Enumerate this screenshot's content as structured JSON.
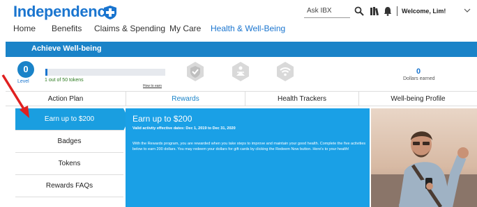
{
  "brand": {
    "name": "Independence",
    "logo_icon": "blue-cross-shield-icon",
    "color": "#1a75cf"
  },
  "header": {
    "search_placeholder": "Ask IBX",
    "welcome": "Welcome, Lim!",
    "icons": [
      "search-icon",
      "books-icon",
      "bell-icon",
      "chevron-down-icon"
    ]
  },
  "topnav": {
    "items": [
      "Home",
      "Benefits",
      "Claims & Spending",
      "My Care",
      "Health & Well-Being"
    ],
    "active": "Health & Well-Being"
  },
  "banner": {
    "title": "Achieve Well-being",
    "color": "#1a83c8"
  },
  "progress": {
    "level_value": "0",
    "level_label": "Level",
    "tokens_text": "1 out of 50 tokens",
    "tokens_earned": 1,
    "tokens_total": 50,
    "how_to_earn": "How to earn",
    "token_icons": [
      "checkmark-shield-token-icon",
      "meditation-person-token-icon",
      "wifi-token-icon"
    ],
    "dollars_value": "0",
    "dollars_label": "Dollars earned"
  },
  "tabs": {
    "items": [
      "Action Plan",
      "Rewards",
      "Health Trackers",
      "Well-being Profile"
    ],
    "active": "Rewards"
  },
  "leftnav": {
    "items": [
      "Earn up to $200",
      "Badges",
      "Tokens",
      "Rewards FAQs"
    ],
    "active": "Earn up to $200"
  },
  "panel": {
    "title": "Earn up to $200",
    "dates": "Valid activity effective dates: Dec 1, 2019 to Dec 31, 2020",
    "body": "With the Rewards program, you are rewarded when you take steps to improve and maintain your good health. Complete the five activities below to earn 200 dollars. You may redeem your dollars for gift cards by clicking the Redeem Now button. Here's to your health!",
    "color": "#1aa0e6"
  },
  "photo": {
    "icon": "man-with-phone-photo"
  },
  "annotation": {
    "icon": "red-arrow-icon",
    "color": "#e02020"
  }
}
